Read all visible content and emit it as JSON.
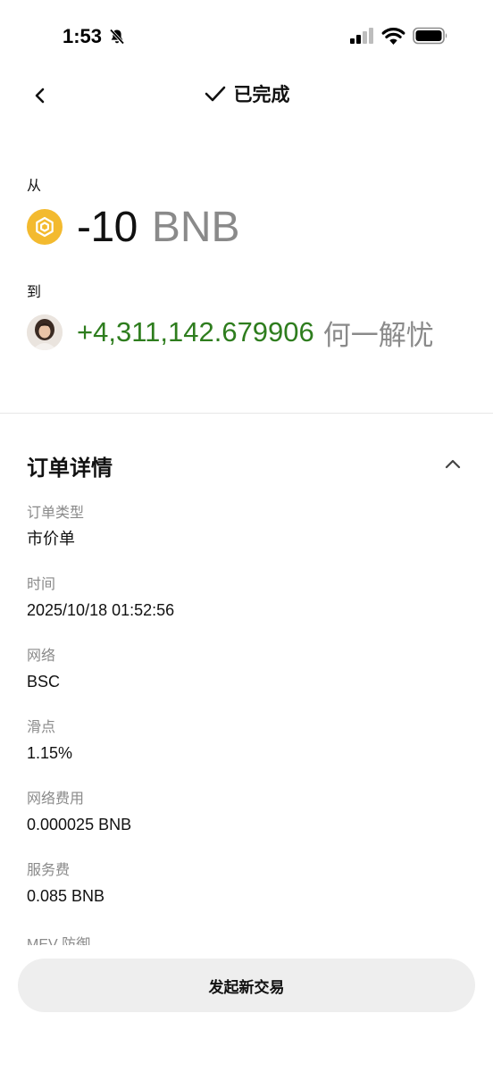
{
  "status_bar": {
    "time": "1:53"
  },
  "header": {
    "title": "已完成"
  },
  "from": {
    "label": "从",
    "amount": "-10",
    "unit": "BNB",
    "icon": "bnb-coin-icon",
    "icon_color": "#f3ba2f"
  },
  "to": {
    "label": "到",
    "amount": "+4,311,142.679906",
    "unit": "何一解忧",
    "amount_color": "#2e7d1e"
  },
  "order_details": {
    "title": "订单详情",
    "items": [
      {
        "label": "订单类型",
        "value": "市价单"
      },
      {
        "label": "时间",
        "value": "2025/10/18 01:52:56"
      },
      {
        "label": "网络",
        "value": "BSC"
      },
      {
        "label": "滑点",
        "value": "1.15%"
      },
      {
        "label": "网络费用",
        "value": "0.000025 BNB"
      },
      {
        "label": "服务费",
        "value": "0.085 BNB"
      }
    ],
    "partial_label": "MEV 防御"
  },
  "actions": {
    "new_trade": "发起新交易"
  }
}
